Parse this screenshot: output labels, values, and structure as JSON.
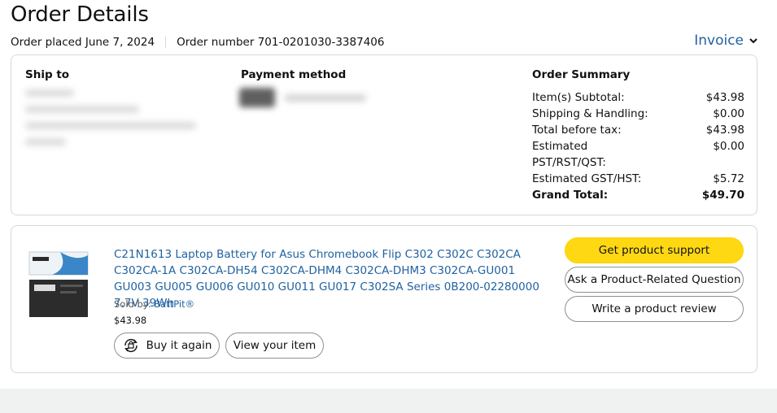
{
  "header": {
    "title": "Order Details",
    "order_placed": "Order placed June 7, 2024",
    "order_number": "Order number 701-0201030-3387406",
    "invoice_label": "Invoice"
  },
  "ship_to": {
    "title": "Ship to"
  },
  "payment": {
    "title": "Payment method"
  },
  "summary": {
    "title": "Order Summary",
    "rows": [
      {
        "label": "Item(s) Subtotal:",
        "value": "$43.98"
      },
      {
        "label": "Shipping & Handling:",
        "value": "$0.00"
      },
      {
        "label": "Total before tax:",
        "value": "$43.98"
      },
      {
        "label": "Estimated PST/RST/QST:",
        "value": "$0.00"
      },
      {
        "label": "Estimated GST/HST:",
        "value": "$5.72"
      },
      {
        "label": "Grand Total:",
        "value": "$49.70"
      }
    ]
  },
  "item": {
    "title": "C21N1613 Laptop Battery for Asus Chromebook Flip C302 C302C C302CA C302CA-1A C302CA-DH54 C302CA-DHM4 C302CA-DHM3 C302CA-GU001 GU003 GU005 GU006 GU010 GU011 GU017 C302SA Series 0B200-02280000 7.7V 39Wh",
    "sold_by_prefix": "Sold by:",
    "seller": "BattPit®",
    "price": "$43.98",
    "buy_again": "Buy it again",
    "view_item": "View your item"
  },
  "actions": {
    "support": "Get product support",
    "ask": "Ask a Product-Related Question",
    "review": "Write a product review"
  }
}
